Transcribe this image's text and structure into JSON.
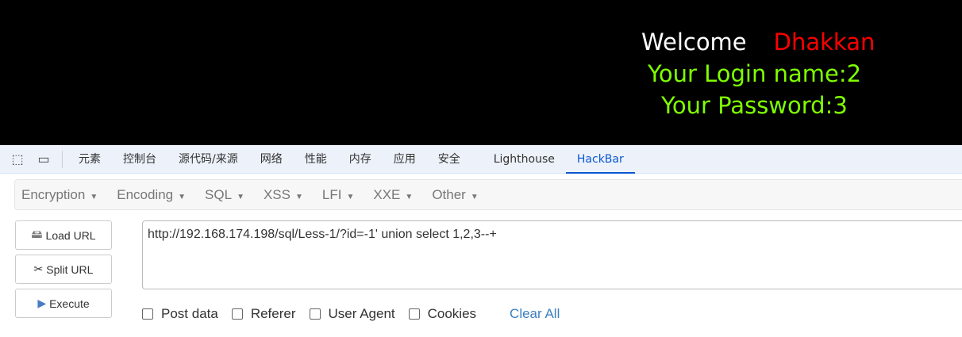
{
  "page": {
    "welcome": "Welcome",
    "user": "Dhakkan",
    "login": "Your Login name:2",
    "password": "Your Password:3",
    "welcome_color": "#ffffff",
    "user_color": "#ff0000",
    "info_color": "#7fff00"
  },
  "devtools": {
    "tabs": [
      "元素",
      "控制台",
      "源代码/来源",
      "网络",
      "性能",
      "内存",
      "应用",
      "安全",
      "Lighthouse",
      "HackBar"
    ],
    "active_tab": "HackBar"
  },
  "hackbar": {
    "menus": [
      "Encryption",
      "Encoding",
      "SQL",
      "XSS",
      "LFI",
      "XXE",
      "Other"
    ],
    "buttons": {
      "load": "Load URL",
      "split": "Split URL",
      "execute": "Execute"
    },
    "url": "http://192.168.174.198/sql/Less-1/?id=-1' union select 1,2,3--+",
    "options": [
      "Post data",
      "Referer",
      "User Agent",
      "Cookies"
    ],
    "clear": "Clear All"
  }
}
